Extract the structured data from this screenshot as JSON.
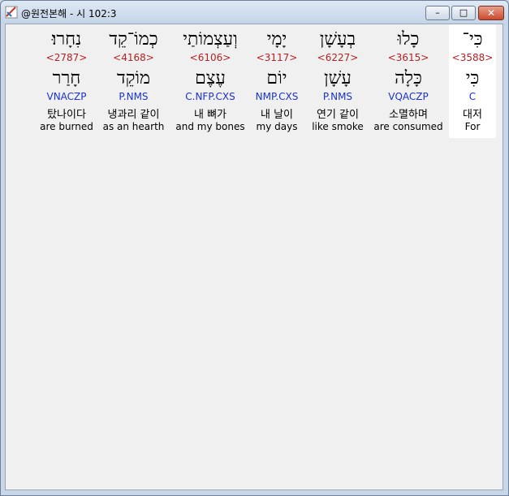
{
  "window": {
    "title": "@원전본해 - 시 102:3"
  },
  "controls": {
    "minimize": "–",
    "maximize": "□",
    "close": "✕"
  },
  "words": [
    {
      "hebrew": "נִחָרוּ׃",
      "strong": "<2787>",
      "lemma": "חָרַר",
      "morph": "VNACZP",
      "korean": "탔나이다",
      "english": "are burned"
    },
    {
      "hebrew": "כְמוֹ־קֵד",
      "strong": "<4168>",
      "lemma": "מוֹקֵד",
      "morph": "P.NMS",
      "korean": "냉과리 같이",
      "english": "as an hearth"
    },
    {
      "hebrew": "וְעַצְמוֹתַי",
      "strong": "<6106>",
      "lemma": "עֶצֶם",
      "morph": "C.NFP.CXS",
      "korean": "내 뼈가",
      "english": "and my bones"
    },
    {
      "hebrew": "יָמָי",
      "strong": "<3117>",
      "lemma": "יוֹם",
      "morph": "NMP.CXS",
      "korean": "내 날이",
      "english": "my days"
    },
    {
      "hebrew": "בְעָשָׁן",
      "strong": "<6227>",
      "lemma": "עָשָׁן",
      "morph": "P.NMS",
      "korean": "연기 같이",
      "english": "like smoke"
    },
    {
      "hebrew": "כָלוּ",
      "strong": "<3615>",
      "lemma": "כָּלָה",
      "morph": "VQACZP",
      "korean": "소멸하며",
      "english": "are consumed"
    },
    {
      "hebrew": "כִּי־",
      "strong": "<3588>",
      "lemma": "כִּי",
      "morph": "C",
      "korean": "대저",
      "english": "For"
    }
  ]
}
